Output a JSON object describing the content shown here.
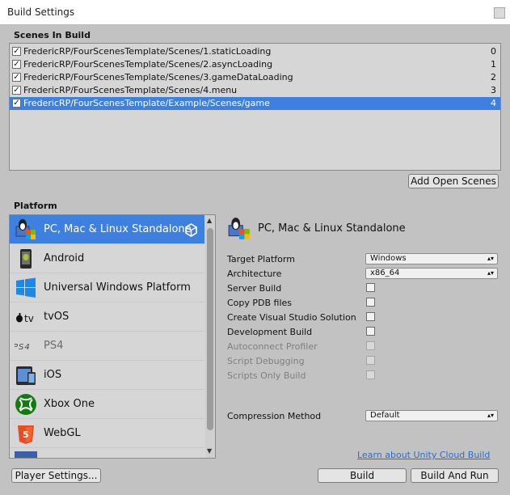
{
  "window": {
    "title": "Build Settings"
  },
  "scenes": {
    "header": "Scenes In Build",
    "items": [
      {
        "path": "FredericRP/FourScenesTemplate/Scenes/1.staticLoading",
        "index": "0",
        "checked": "✓"
      },
      {
        "path": "FredericRP/FourScenesTemplate/Scenes/2.asyncLoading",
        "index": "1",
        "checked": "✓"
      },
      {
        "path": "FredericRP/FourScenesTemplate/Scenes/3.gameDataLoading",
        "index": "2",
        "checked": "✓"
      },
      {
        "path": "FredericRP/FourScenesTemplate/Scenes/4.menu",
        "index": "3",
        "checked": "✓"
      },
      {
        "path": "FredericRP/FourScenesTemplate/Example/Scenes/game",
        "index": "4",
        "checked": "✓"
      }
    ],
    "add_open_scenes": "Add Open Scenes"
  },
  "platform": {
    "header": "Platform",
    "items": [
      {
        "label": "PC, Mac & Linux Standalone",
        "icon": "pc-mac-linux-icon"
      },
      {
        "label": "Android",
        "icon": "android-icon"
      },
      {
        "label": "Universal Windows Platform",
        "icon": "windows-icon"
      },
      {
        "label": "tvOS",
        "icon": "apple-tv-icon"
      },
      {
        "label": "PS4",
        "icon": "ps4-icon"
      },
      {
        "label": "iOS",
        "icon": "ios-icon"
      },
      {
        "label": "Xbox One",
        "icon": "xbox-icon"
      },
      {
        "label": "WebGL",
        "icon": "html5-icon"
      }
    ]
  },
  "detail": {
    "title": "PC, Mac & Linux Standalone",
    "target_platform_label": "Target Platform",
    "target_platform_value": "Windows",
    "architecture_label": "Architecture",
    "architecture_value": "x86_64",
    "server_build": "Server Build",
    "copy_pdb": "Copy PDB files",
    "create_vs": "Create Visual Studio Solution",
    "development_build": "Development Build",
    "autoconnect_profiler": "Autoconnect Profiler",
    "script_debugging": "Script Debugging",
    "scripts_only": "Scripts Only Build",
    "compression_label": "Compression Method",
    "compression_value": "Default",
    "dropdown_arrow": "▴▾"
  },
  "footer": {
    "cloud_link": "Learn about Unity Cloud Build",
    "player_settings": "Player Settings...",
    "build": "Build",
    "build_and_run": "Build And Run"
  },
  "colors": {
    "selection": "#3d80df",
    "background": "#c2c2c2",
    "link": "#2d6cc9"
  }
}
